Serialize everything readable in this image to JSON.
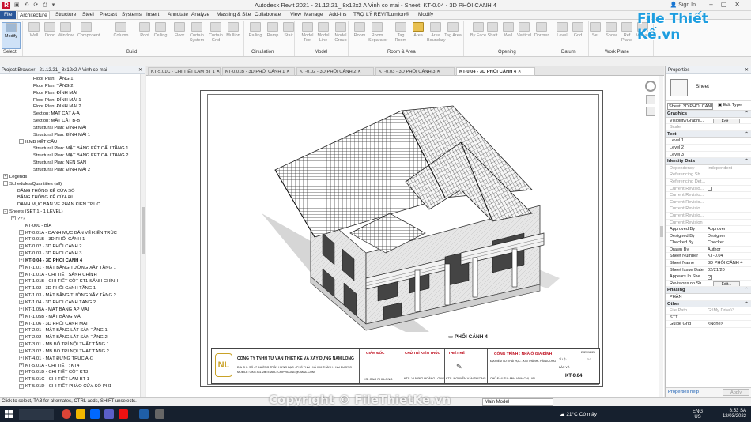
{
  "window": {
    "title": "Autodesk Revit 2021 - 21.12.21_ 8x12x2 A Vinh co mai - Sheet: KT-0.04 - 3D PHỐI CẢNH 4",
    "sign_in": "Sign In",
    "help": "?"
  },
  "ribbon_tabs": [
    "File",
    "Architecture",
    "Structure",
    "Steel",
    "Precast",
    "Systems",
    "Insert",
    "Annotate",
    "Analyze",
    "Massing & Site",
    "Collaborate",
    "View",
    "Manage",
    "Add-Ins",
    "TRỢ LÝ REVIT",
    "Lumion®",
    "Modify"
  ],
  "active_tab": "Architecture",
  "ribbon_buttons": [
    "Modify",
    "Wall",
    "Door",
    "Window",
    "Component",
    "Column",
    "Roof",
    "Ceiling",
    "Floor",
    "Curtain System",
    "Curtain Grid",
    "Mullion",
    "Railing",
    "Ramp",
    "Stair",
    "Model Text",
    "Model Line",
    "Model Group",
    "Room",
    "Room Separator",
    "Tag Room",
    "Area",
    "Area Boundary",
    "Tag Area",
    "By Face",
    "Shaft",
    "Wall",
    "Vertical",
    "Dormer",
    "Level",
    "Grid",
    "Set",
    "Show",
    "Ref Plane",
    "Viewer"
  ],
  "ribbon_panels": [
    "Select",
    "Build",
    "Circulation",
    "Model",
    "Room & Area",
    "Opening",
    "Datum",
    "Work Plane"
  ],
  "browser": {
    "title": "Project Browser - 21.12.21_ 8x12x2 A Vinh co mai",
    "items": [
      {
        "label": "Floor Plan: TẦNG 1",
        "indent": 3,
        "toggle": ""
      },
      {
        "label": "Floor Plan: TẦNG 2",
        "indent": 3,
        "toggle": ""
      },
      {
        "label": "Floor Plan: ĐỈNH MÁI",
        "indent": 3,
        "toggle": ""
      },
      {
        "label": "Floor Plan: ĐỈNH MÁI 1",
        "indent": 3,
        "toggle": ""
      },
      {
        "label": "Floor Plan: ĐỈNH MÁI 2",
        "indent": 3,
        "toggle": ""
      },
      {
        "label": "Section: MẶT CẮT A-A",
        "indent": 3,
        "toggle": ""
      },
      {
        "label": "Section: MẶT CẮT B-B",
        "indent": 3,
        "toggle": ""
      },
      {
        "label": "Structural Plan: ĐỈNH MÁI",
        "indent": 3,
        "toggle": ""
      },
      {
        "label": "Structural Plan: ĐỈNH MÁI 1",
        "indent": 3,
        "toggle": ""
      },
      {
        "label": "II.MB KẾT CẤU",
        "indent": 2,
        "toggle": "-"
      },
      {
        "label": "Structural Plan: MẶT BẰNG KẾT CẤU TẦNG 1",
        "indent": 3,
        "toggle": ""
      },
      {
        "label": "Structural Plan: MẶT BẰNG KẾT CẤU TẦNG 2",
        "indent": 3,
        "toggle": ""
      },
      {
        "label": "Structural Plan: NỀN SÂN",
        "indent": 3,
        "toggle": ""
      },
      {
        "label": "Structural Plan: ĐỈNH MÁI 2",
        "indent": 3,
        "toggle": ""
      },
      {
        "label": "Legends",
        "indent": 0,
        "toggle": "+"
      },
      {
        "label": "Schedules/Quantities (all)",
        "indent": 0,
        "toggle": "-"
      },
      {
        "label": "BẢNG THỐNG KÊ CỬA SỔ",
        "indent": 1,
        "toggle": ""
      },
      {
        "label": "BẢNG THỐNG KÊ CỬA ĐI",
        "indent": 1,
        "toggle": ""
      },
      {
        "label": "DANH MỤC BẢN VẼ PHẦN KIẾN TRÚC",
        "indent": 1,
        "toggle": ""
      },
      {
        "label": "Sheets (SET 1 - 1 LEVEL)",
        "indent": 0,
        "toggle": "-"
      },
      {
        "label": "???",
        "indent": 1,
        "toggle": "-"
      },
      {
        "label": "KT-000 - BÌA",
        "indent": 2,
        "toggle": ""
      },
      {
        "label": "KT-0.01A - DANH MỤC BẢN VẼ KIẾN TRÚC",
        "indent": 2,
        "toggle": "+"
      },
      {
        "label": "KT-0.01B - 3D PHỐI CẢNH 1",
        "indent": 2,
        "toggle": "+"
      },
      {
        "label": "KT-0.02 - 3D PHỐI CẢNH 2",
        "indent": 2,
        "toggle": "+"
      },
      {
        "label": "KT-0.03 - 3D PHỐI CẢNH 3",
        "indent": 2,
        "toggle": "+"
      },
      {
        "label": "KT-0.04 - 3D PHỐI CẢNH 4",
        "indent": 2,
        "toggle": "+",
        "selected": true
      },
      {
        "label": "KT-1.01 - MẶT BẰNG TƯỜNG XÂY TẦNG 1",
        "indent": 2,
        "toggle": "+"
      },
      {
        "label": "KT-1.01A - CHI TIẾT SẢNH CHÍNH",
        "indent": 2,
        "toggle": "+"
      },
      {
        "label": "KT-1.01B - CHI TIẾT CỘT KT1-SẢNH CHÍNH",
        "indent": 2,
        "toggle": "+"
      },
      {
        "label": "KT-1.02 - 3D PHỐI CẢNH TẦNG 1",
        "indent": 2,
        "toggle": "+"
      },
      {
        "label": "KT-1.03 - MẶT BẰNG TƯỜNG XÂY TẦNG 2",
        "indent": 2,
        "toggle": "+"
      },
      {
        "label": "KT-1.04 - 3D PHỐI CẢNH TẦNG 2",
        "indent": 2,
        "toggle": "+"
      },
      {
        "label": "KT-1.05A - MẶT BẰNG ÁP MÁI",
        "indent": 2,
        "toggle": "+"
      },
      {
        "label": "KT-1.05B - MẶT BẰNG MÁI",
        "indent": 2,
        "toggle": "+"
      },
      {
        "label": "KT-1.06 - 3D PHỐI CẢNH MÁI",
        "indent": 2,
        "toggle": "+"
      },
      {
        "label": "KT-2.01 - MẶT BẰNG LÁT SÀN TẦNG 1",
        "indent": 2,
        "toggle": "+"
      },
      {
        "label": "KT-2.02 - MẶT BẰNG LÁT SÀN TẦNG 2",
        "indent": 2,
        "toggle": "+"
      },
      {
        "label": "KT-3.01 - MB BỐ TRÍ NỘI THẤT TẦNG 1",
        "indent": 2,
        "toggle": "+"
      },
      {
        "label": "KT-3.02 - MB BỐ TRÍ NỘI THẤT TẦNG 2",
        "indent": 2,
        "toggle": "+"
      },
      {
        "label": "KT-4.01 - MẶT ĐỨNG TRỤC A-C",
        "indent": 2,
        "toggle": "+"
      },
      {
        "label": "KT-5.01A - CHI TIẾT : KT4",
        "indent": 2,
        "toggle": "+"
      },
      {
        "label": "KT-5.01B - CHI TIẾT CỘT KT3",
        "indent": 2,
        "toggle": "+"
      },
      {
        "label": "KT-5.01C - CHI TIẾT LAM BT 1",
        "indent": 2,
        "toggle": "+"
      },
      {
        "label": "KT-5.01D - CHI TIẾT PHÀO CỬA SỔ-PH1",
        "indent": 2,
        "toggle": "+"
      }
    ]
  },
  "view_tabs": [
    {
      "label": "KT-5.01C - CHI TIẾT LAM BT 1",
      "active": false
    },
    {
      "label": "KT-0.01B - 3D PHỐI CẢNH 1",
      "active": false
    },
    {
      "label": "KT-0.02 - 3D PHỐI CẢNH 2",
      "active": false
    },
    {
      "label": "KT-0.03 - 3D PHỐI CẢNH 3",
      "active": false
    },
    {
      "label": "KT-0.04 - 3D PHỐI CẢNH 4",
      "active": true
    }
  ],
  "sheet": {
    "view_title": "PHỐI CẢNH 4",
    "company": "CÔNG TY TNHH TƯ VẤN THIẾT KẾ VÀ XÂY DỰNG NAM LONG",
    "address": "ĐỊA CHỈ: SỐ 47 ĐƯỜNG TRẦN HƯNG ĐẠO - PHỐ THÁI - XÃ KIM THÀNH - HẢI DƯƠNG",
    "contact": "MOBILE: 0904 441 286  EMAIL: CHIPHILONG@GMAIL.COM",
    "roles": [
      "GIÁM ĐỐC",
      "CHỦ TRÌ KIẾN TRÚC",
      "THIẾT KẾ"
    ],
    "names": [
      "KS. CAO PHI LONG",
      "KTS. VƯƠNG HOÀNG LONG",
      "KTS. NGUYỄN VĂN DƯƠNG"
    ],
    "project_label": "CÔNG TRÌNH : NHÀ Ở GIA ĐÌNH",
    "location": "ĐỊA ĐIỂM XD: THÁI HỌC - KIM THÀNH - HẢI DƯƠNG",
    "owner": "CHỦ ĐẦU TƯ: ANH VINH CHỊ LAN",
    "date": "2021/12/21",
    "number": "KT-0.04",
    "scale_label": "TỈ LỆ:",
    "scale": "1:1",
    "drawing_label": "BẢN VẼ:"
  },
  "properties": {
    "title": "Properties",
    "type_name": "Sheet",
    "instance": "Sheet: 3D PHỐI CẢNI",
    "edit_type": "Edit Type",
    "groups": [
      {
        "name": "Graphics",
        "rows": [
          {
            "k": "Visibility/Graphi...",
            "v": "",
            "btn": "Edit..."
          },
          {
            "k": "Scale",
            "v": "",
            "grey": true
          }
        ]
      },
      {
        "name": "Text",
        "rows": [
          {
            "k": "Level 1",
            "v": ""
          },
          {
            "k": "Level 2",
            "v": ""
          },
          {
            "k": "Level 3",
            "v": ""
          }
        ]
      },
      {
        "name": "Identity Data",
        "rows": [
          {
            "k": "Dependency",
            "v": "Independent",
            "grey": true
          },
          {
            "k": "Referencing Sh...",
            "v": "",
            "grey": true
          },
          {
            "k": "Referencing Det...",
            "v": "",
            "grey": true
          },
          {
            "k": "Current Revisio...",
            "v": "",
            "grey": true,
            "chk": ""
          },
          {
            "k": "Current Revisio...",
            "v": "",
            "grey": true
          },
          {
            "k": "Current Revisio...",
            "v": "",
            "grey": true
          },
          {
            "k": "Current Revisio...",
            "v": "",
            "grey": true
          },
          {
            "k": "Current Revisio...",
            "v": "",
            "grey": true
          },
          {
            "k": "Current Revision",
            "v": "",
            "grey": true
          },
          {
            "k": "Approved By",
            "v": "Approver"
          },
          {
            "k": "Designed By",
            "v": "Designer"
          },
          {
            "k": "Checked By",
            "v": "Checker"
          },
          {
            "k": "Drawn By",
            "v": "Author"
          },
          {
            "k": "Sheet Number",
            "v": "KT-0.04"
          },
          {
            "k": "Sheet Name",
            "v": "3D PHỐI CẢNH 4"
          },
          {
            "k": "Sheet Issue Date",
            "v": "02/21/20"
          },
          {
            "k": "Appears In She...",
            "v": "",
            "chk": "✓"
          },
          {
            "k": "Revisions on Sh...",
            "v": "",
            "btn": "Edit..."
          }
        ]
      },
      {
        "name": "Phasing",
        "rows": [
          {
            "k": "PHẦN",
            "v": ""
          }
        ]
      },
      {
        "name": "Other",
        "rows": [
          {
            "k": "File Path",
            "v": "G:\\My Drive\\3.",
            "grey": true
          },
          {
            "k": "STT",
            "v": ""
          },
          {
            "k": "Guide Grid",
            "v": "<None>"
          }
        ]
      }
    ],
    "help": "Properties help",
    "apply": "Apply"
  },
  "status": {
    "message": "Click to select, TAB for alternates, CTRL adds, SHIFT unselects.",
    "model": "Main Model"
  },
  "taskbar": {
    "weather": "21°C  Có mây",
    "lang1": "ENG",
    "lang2": "US",
    "time": "8:53 SA",
    "date": "12/03/2022"
  },
  "watermark": {
    "logo": "File Thiết Kế.vn",
    "copyright": "Copyright © FileThietKe.vn"
  }
}
